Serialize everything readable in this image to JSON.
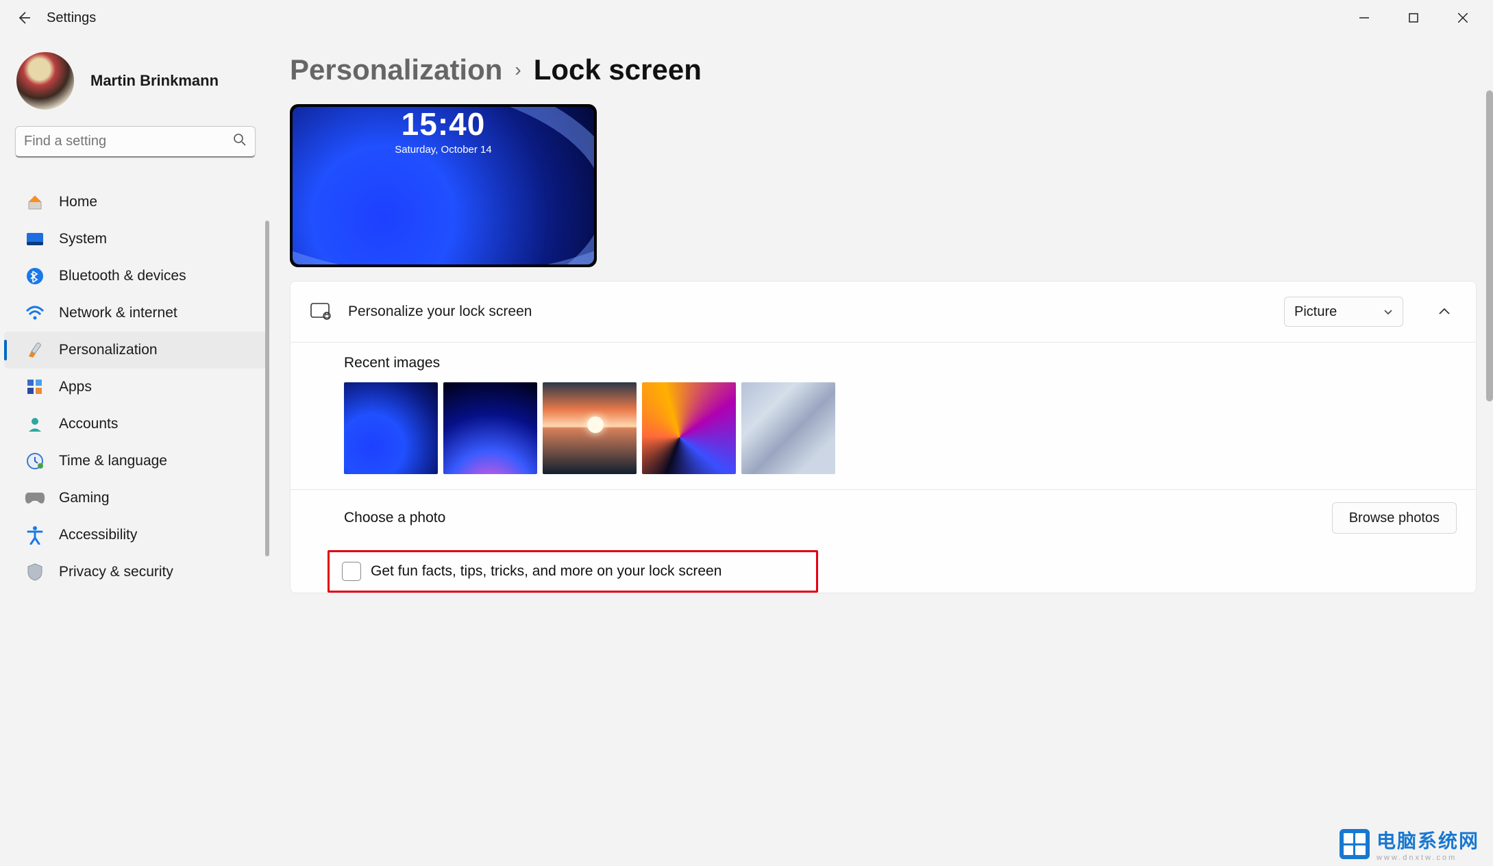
{
  "window": {
    "app_title": "Settings",
    "minimize": "–",
    "maximize": "▢",
    "close": "✕"
  },
  "user": {
    "name": "Martin Brinkmann"
  },
  "search": {
    "placeholder": "Find a setting"
  },
  "nav": {
    "home": "Home",
    "system": "System",
    "bluetooth": "Bluetooth & devices",
    "network": "Network & internet",
    "personalization": "Personalization",
    "apps": "Apps",
    "accounts": "Accounts",
    "time": "Time & language",
    "gaming": "Gaming",
    "accessibility": "Accessibility",
    "privacy": "Privacy & security"
  },
  "breadcrumb": {
    "parent": "Personalization",
    "current": "Lock screen"
  },
  "preview": {
    "time": "15:40",
    "date": "Saturday, October 14"
  },
  "personalize": {
    "title": "Personalize your lock screen",
    "dropdown_value": "Picture"
  },
  "recent": {
    "label": "Recent images"
  },
  "choose": {
    "label": "Choose a photo",
    "button": "Browse photos"
  },
  "funfacts": {
    "label": "Get fun facts, tips, tricks, and more on your lock screen",
    "checked": false
  },
  "watermark": {
    "cn": "电脑系统网",
    "en": "www.dnxtw.com"
  }
}
